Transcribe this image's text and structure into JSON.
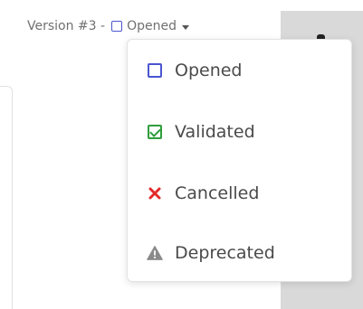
{
  "header": {
    "version_label": "Version #3 -",
    "current_status": "Opened"
  },
  "status_menu": {
    "items": [
      {
        "label": "Opened",
        "icon": "empty-square-icon",
        "color": "#4a55d0"
      },
      {
        "label": "Validated",
        "icon": "check-square-icon",
        "color": "#2e9e3c"
      },
      {
        "label": "Cancelled",
        "icon": "red-x-icon",
        "color": "#e32b2b"
      },
      {
        "label": "Deprecated",
        "icon": "warning-triangle-icon",
        "color": "#8a8a8a"
      }
    ]
  },
  "colors": {
    "opened": "#4a55d0",
    "validated": "#2e9e3c",
    "cancelled": "#e32b2b",
    "deprecated": "#8a8a8a",
    "panel_gray": "#d9d9d9"
  }
}
